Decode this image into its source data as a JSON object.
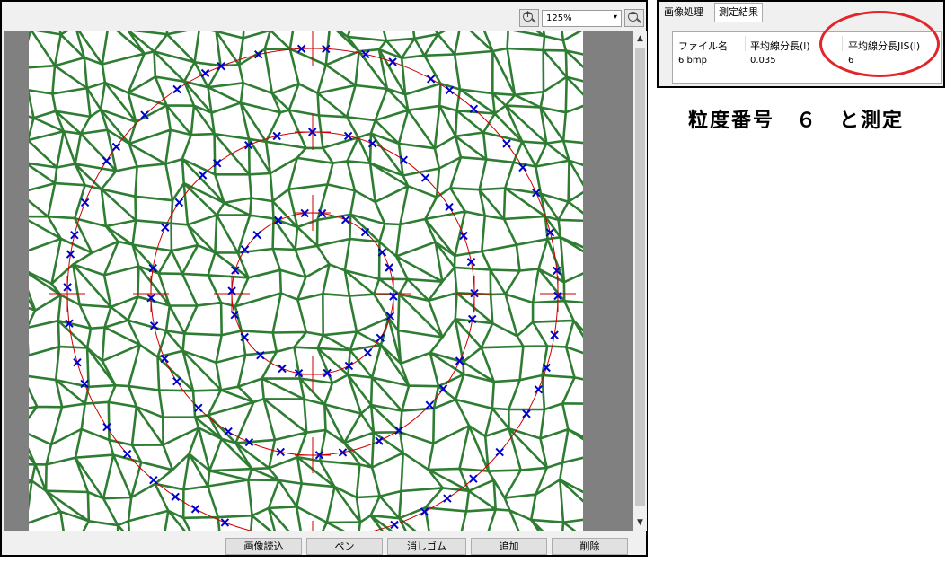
{
  "toolbar": {
    "zoom_value": "125%",
    "zoom_in_sign": "+",
    "zoom_out_sign": "−",
    "dropdown_arrow": "▾"
  },
  "scrollbar": {
    "up_arrow": "▲",
    "down_arrow": "▼"
  },
  "buttons": {
    "load_image": "画像読込",
    "pen": "ペン",
    "eraser": "消しゴム",
    "add": "追加",
    "delete": "削除"
  },
  "tabs": {
    "image_processing": "画像処理",
    "measurement_result": "測定結果"
  },
  "results_table": {
    "headers": [
      "ファイル名",
      "平均線分長(l)",
      "平均線分長JIS(l)"
    ],
    "row": [
      "6 bmp",
      "0.035",
      "6"
    ]
  },
  "annotation": {
    "text": "粒度番号　６　と測定",
    "highlight_color": "#e0262a"
  },
  "image": {
    "grain_line_color": "#2e7d32",
    "circle_color": "#cc0000",
    "marker_color": "#0000cc",
    "circles": [
      {
        "name": "outer",
        "r": 273
      },
      {
        "name": "middle",
        "r": 180
      },
      {
        "name": "inner",
        "r": 90
      }
    ]
  }
}
